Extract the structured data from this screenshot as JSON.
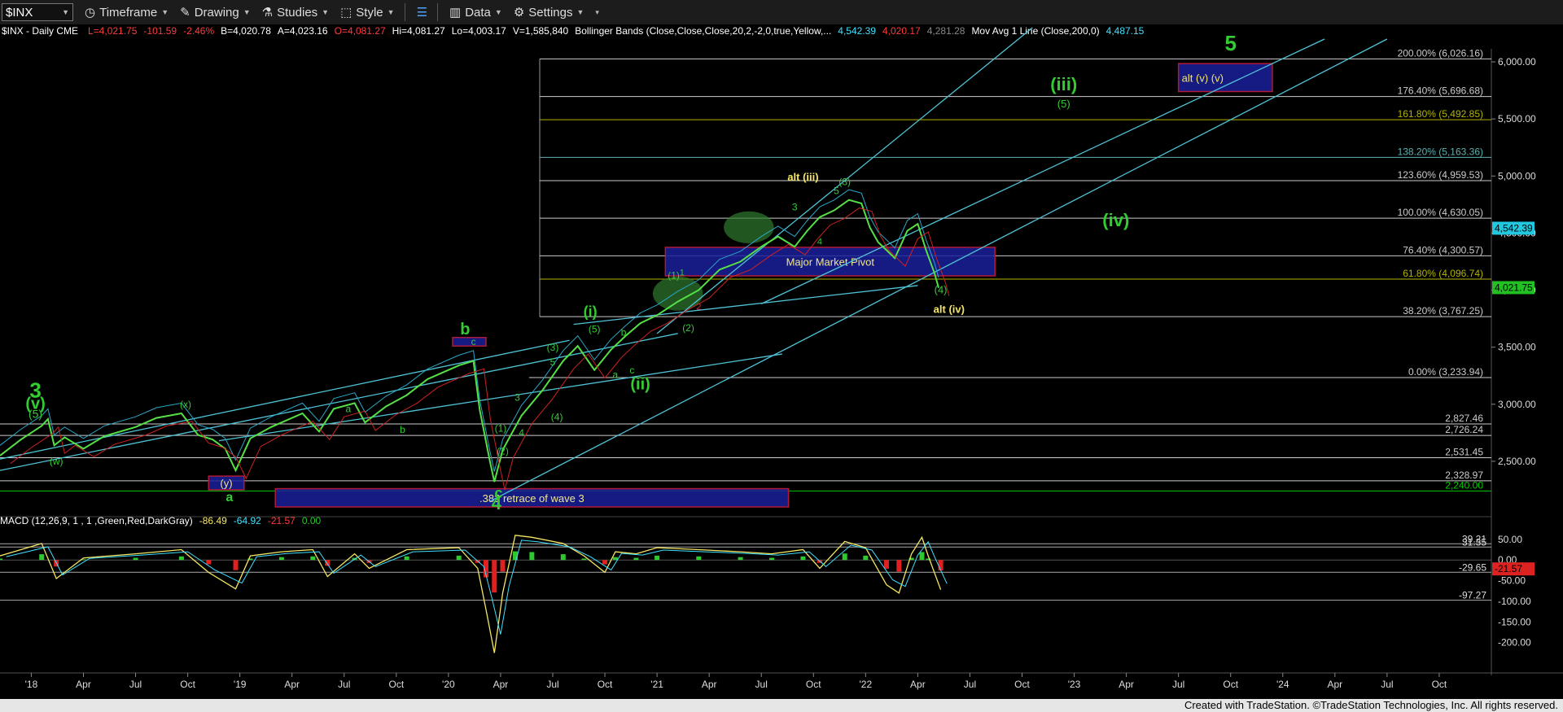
{
  "toolbar": {
    "symbol": "$INX",
    "items": [
      "Timeframe",
      "Drawing",
      "Studies",
      "Style",
      "Data",
      "Settings"
    ]
  },
  "header": {
    "symbol_info": "$INX - Daily  CME",
    "ohlc": [
      {
        "text": "L=4,021.75",
        "color": "#ff3b3b"
      },
      {
        "text": "-101.59",
        "color": "#ff3b3b"
      },
      {
        "text": "-2.46%",
        "color": "#ff3b3b"
      },
      {
        "text": "B=4,020.78",
        "color": "#ffffff"
      },
      {
        "text": "A=4,023.16",
        "color": "#ffffff"
      },
      {
        "text": "O=4,081.27",
        "color": "#ff3b3b"
      },
      {
        "text": "Hi=4,081.27",
        "color": "#ffffff"
      },
      {
        "text": "Lo=4,003.17",
        "color": "#ffffff"
      },
      {
        "text": "V=1,585,840",
        "color": "#ffffff"
      },
      {
        "text": "Bollinger Bands (Close,Close,Close,20,2,-2,0,true,Yellow,...",
        "color": "#ffffff"
      },
      {
        "text": "4,542.39",
        "color": "#3fe0ff"
      },
      {
        "text": "4,020.17",
        "color": "#ff3b3b"
      },
      {
        "text": "4,281.28",
        "color": "#888888"
      },
      {
        "text": "Mov Avg 1 Line (Close,200,0)",
        "color": "#ffffff"
      },
      {
        "text": "4,487.15",
        "color": "#3fe0ff"
      }
    ],
    "macd_label": "MACD (12,26,9, 1 , 1 ,Green,Red,DarkGray)",
    "macd_values": [
      {
        "text": "-86.49",
        "color": "#f5e663"
      },
      {
        "text": "-64.92",
        "color": "#3fe0ff"
      },
      {
        "text": "-21.57",
        "color": "#ff3b3b"
      },
      {
        "text": "0.00",
        "color": "#27c427"
      }
    ]
  },
  "footer": {
    "text": "Created with TradeStation. ©TradeStation Technologies, Inc. All rights reserved."
  },
  "chart_data": [
    {
      "type": "line",
      "title": "$INX - Daily",
      "y_axis_ticks": [
        "6,000.00",
        "5,500.00",
        "5,000.00",
        "4,500.00",
        "4,000.00",
        "3,500.00",
        "3,000.00",
        "2,500.00"
      ],
      "y_axis_tick_values": [
        6000,
        5500,
        5000,
        4500,
        4000,
        3500,
        3000,
        2500
      ],
      "ylim": [
        2050,
        6200
      ],
      "x_axis_ticks": [
        "'18",
        "Apr",
        "Jul",
        "Oct",
        "'19",
        "Apr",
        "Jul",
        "Oct",
        "'20",
        "Apr",
        "Jul",
        "Oct",
        "'21",
        "Apr",
        "Jul",
        "Oct",
        "'22",
        "Apr",
        "Jul",
        "Oct",
        "'23",
        "Apr",
        "Jul",
        "Oct",
        "'24",
        "Apr",
        "Jul",
        "Oct"
      ],
      "x_axis_tick_values": [
        2018.0,
        2018.25,
        2018.5,
        2018.75,
        2019.0,
        2019.25,
        2019.5,
        2019.75,
        2020.0,
        2020.25,
        2020.5,
        2020.75,
        2021.0,
        2021.25,
        2021.5,
        2021.75,
        2022.0,
        2022.25,
        2022.5,
        2022.75,
        2023.0,
        2023.25,
        2023.5,
        2023.75,
        2024.0,
        2024.25,
        2024.5,
        2024.75
      ],
      "xlim": [
        2017.85,
        2025.0
      ],
      "series": [
        {
          "x": [
            2017.85,
            2017.95,
            2018.05,
            2018.08,
            2018.11,
            2018.16,
            2018.25,
            2018.35,
            2018.5,
            2018.6,
            2018.72,
            2018.8,
            2018.87,
            2018.93,
            2018.98,
            2019.05,
            2019.15,
            2019.3,
            2019.38,
            2019.45,
            2019.55,
            2019.6,
            2019.7,
            2019.8,
            2019.9,
            2020.05,
            2020.12,
            2020.15,
            2020.2,
            2020.22,
            2020.26,
            2020.35,
            2020.45,
            2020.55,
            2020.62,
            2020.7,
            2020.78,
            2020.85,
            2020.92,
            2021.0,
            2021.1,
            2021.2,
            2021.3,
            2021.4,
            2021.5,
            2021.58,
            2021.66,
            2021.72,
            2021.78,
            2021.85,
            2021.92,
            2021.98,
            2022.02,
            2022.06,
            2022.1,
            2022.14,
            2022.2,
            2022.25,
            2022.29,
            2022.33,
            2022.35
          ],
          "y": [
            2550,
            2690,
            2810,
            2870,
            2640,
            2710,
            2610,
            2720,
            2800,
            2880,
            2920,
            2730,
            2690,
            2610,
            2420,
            2700,
            2800,
            2920,
            2760,
            2960,
            3010,
            2840,
            2980,
            3080,
            3220,
            3340,
            3380,
            2950,
            2490,
            2320,
            2600,
            2900,
            3120,
            3380,
            3510,
            3300,
            3480,
            3600,
            3710,
            3780,
            3900,
            4000,
            4180,
            4250,
            4380,
            4470,
            4380,
            4520,
            4640,
            4700,
            4790,
            4760,
            4550,
            4420,
            4350,
            4280,
            4520,
            4580,
            4350,
            4150,
            4020
          ]
        }
      ],
      "price_levels": [
        {
          "value": 2240,
          "label": "2,240.00",
          "color": "#00cc00"
        },
        {
          "value": 2328.97,
          "label": "2,328.97",
          "color": "#cccccc"
        },
        {
          "value": 2531.45,
          "label": "2,531.45",
          "color": "#cccccc"
        },
        {
          "value": 2726.24,
          "label": "2,726.24",
          "color": "#cccccc"
        },
        {
          "value": 2827.46,
          "label": "2,827.46",
          "color": "#cccccc"
        }
      ],
      "fib_levels": [
        {
          "value": 3233.94,
          "label": "0.00% (3,233.94)",
          "color": "#cccccc"
        },
        {
          "value": 3767.25,
          "label": "38.20% (3,767.25)",
          "color": "#cccccc"
        },
        {
          "value": 4096.74,
          "label": "61.80% (4,096.74)",
          "color": "#b3b300"
        },
        {
          "value": 4300.57,
          "label": "76.40% (4,300.57)",
          "color": "#cccccc"
        },
        {
          "value": 4630.05,
          "label": "100.00% (4,630.05)",
          "color": "#cccccc"
        },
        {
          "value": 4959.53,
          "label": "123.60% (4,959.53)",
          "color": "#cccccc"
        },
        {
          "value": 5163.36,
          "label": "138.20% (5,163.36)",
          "color": "#5fb0b0"
        },
        {
          "value": 5492.85,
          "label": "161.80% (5,492.85)",
          "color": "#b3b300"
        },
        {
          "value": 5696.68,
          "label": "176.40% (5,696.68)",
          "color": "#cccccc"
        },
        {
          "value": 6026.16,
          "label": "200.00% (6,026.16)",
          "color": "#cccccc"
        }
      ],
      "price_badges": [
        {
          "value": 4542.39,
          "label": "4,542.39",
          "color": "#22c7e0"
        },
        {
          "value": 4021.75,
          "label": "4,021.75",
          "color": "#22c022"
        }
      ],
      "trend_lines": [
        {
          "x1": 2017.85,
          "y1": 2420,
          "x2": 2021.1,
          "y2": 3620
        },
        {
          "x1": 2017.85,
          "y1": 2520,
          "x2": 2020.58,
          "y2": 3560
        },
        {
          "x1": 2018.9,
          "y1": 2680,
          "x2": 2021.6,
          "y2": 3440
        },
        {
          "x1": 2020.2,
          "y1": 2150,
          "x2": 2024.5,
          "y2": 6200
        },
        {
          "x1": 2021.0,
          "y1": 3620,
          "x2": 2022.8,
          "y2": 6300
        },
        {
          "x1": 2021.5,
          "y1": 3880,
          "x2": 2024.2,
          "y2": 6200
        },
        {
          "x1": 2020.6,
          "y1": 3700,
          "x2": 2022.25,
          "y2": 4040
        }
      ],
      "zones": [
        {
          "x1": 2018.85,
          "x2": 2019.02,
          "y1": 2250,
          "y2": 2370,
          "label": "(y)"
        },
        {
          "x1": 2020.02,
          "x2": 2020.18,
          "y1": 3510,
          "y2": 3585,
          "label": ""
        },
        {
          "x1": 2019.17,
          "x2": 2021.63,
          "y1": 2100,
          "y2": 2260,
          "label": ".382 retrace of wave 3"
        },
        {
          "x1": 2021.04,
          "x2": 2022.62,
          "y1": 4125,
          "y2": 4375,
          "label": "Major Market Pivot"
        },
        {
          "x1": 2023.5,
          "x2": 2023.95,
          "y1": 5740,
          "y2": 5985,
          "label": "alt (v) (v)"
        }
      ],
      "ellipses": [
        {
          "cx": 2021.44,
          "cy": 4550,
          "rx": 0.12,
          "ry": 140
        },
        {
          "cx": 2021.1,
          "cy": 3970,
          "rx": 0.12,
          "ry": 150
        }
      ],
      "annotations": [
        {
          "text": "3",
          "x": 2018.02,
          "y": 3060,
          "color": "#33cc33",
          "size": 26,
          "bold": true
        },
        {
          "text": "(v)",
          "x": 2018.02,
          "y": 2960,
          "color": "#33cc33",
          "size": 20,
          "bold": true
        },
        {
          "text": "(5)",
          "x": 2018.02,
          "y": 2880,
          "color": "#33cc33",
          "size": 14
        },
        {
          "text": "(w)",
          "x": 2018.12,
          "y": 2470,
          "color": "#33cc33",
          "size": 12
        },
        {
          "text": "(x)",
          "x": 2018.74,
          "y": 2970,
          "color": "#33cc33",
          "size": 12
        },
        {
          "text": "a",
          "x": 2018.95,
          "y": 2150,
          "color": "#33cc33",
          "size": 16,
          "bold": true
        },
        {
          "text": "a",
          "x": 2019.52,
          "y": 2930,
          "color": "#33cc33",
          "size": 12
        },
        {
          "text": "b",
          "x": 2019.78,
          "y": 2750,
          "color": "#33cc33",
          "size": 12
        },
        {
          "text": "b",
          "x": 2020.08,
          "y": 3610,
          "color": "#33cc33",
          "size": 20,
          "bold": true
        },
        {
          "text": "c",
          "x": 2020.12,
          "y": 3520,
          "color": "#33cc33",
          "size": 12
        },
        {
          "text": "c",
          "x": 2020.24,
          "y": 2180,
          "color": "#33cc33",
          "size": 18,
          "bold": true
        },
        {
          "text": "4",
          "x": 2020.23,
          "y": 2080,
          "color": "#33cc33",
          "size": 22,
          "bold": true
        },
        {
          "text": "(1)",
          "x": 2020.25,
          "y": 2760,
          "color": "#33cc33",
          "size": 12
        },
        {
          "text": "(2)",
          "x": 2020.26,
          "y": 2560,
          "color": "#33cc33",
          "size": 12
        },
        {
          "text": "3",
          "x": 2020.33,
          "y": 3030,
          "color": "#33cc33",
          "size": 12
        },
        {
          "text": "4",
          "x": 2020.35,
          "y": 2720,
          "color": "#33cc33",
          "size": 12
        },
        {
          "text": "(3)",
          "x": 2020.5,
          "y": 3470,
          "color": "#33cc33",
          "size": 12
        },
        {
          "text": "5",
          "x": 2020.5,
          "y": 3340,
          "color": "#33cc33",
          "size": 12
        },
        {
          "text": "(4)",
          "x": 2020.52,
          "y": 2860,
          "color": "#33cc33",
          "size": 12
        },
        {
          "text": "(5)",
          "x": 2020.7,
          "y": 3630,
          "color": "#33cc33",
          "size": 12
        },
        {
          "text": "(i)",
          "x": 2020.68,
          "y": 3770,
          "color": "#33cc33",
          "size": 18,
          "bold": true
        },
        {
          "text": "a",
          "x": 2020.8,
          "y": 3230,
          "color": "#33cc33",
          "size": 12
        },
        {
          "text": "b",
          "x": 2020.84,
          "y": 3600,
          "color": "#33cc33",
          "size": 12
        },
        {
          "text": "c",
          "x": 2020.88,
          "y": 3270,
          "color": "#33cc33",
          "size": 12
        },
        {
          "text": "(ii)",
          "x": 2020.92,
          "y": 3130,
          "color": "#33cc33",
          "size": 20,
          "bold": true
        },
        {
          "text": "(1)",
          "x": 2021.08,
          "y": 4100,
          "color": "#33cc33",
          "size": 12
        },
        {
          "text": "1",
          "x": 2021.12,
          "y": 4130,
          "color": "#33cc33",
          "size": 11
        },
        {
          "text": "2",
          "x": 2021.2,
          "y": 3830,
          "color": "#cc3333",
          "size": 11
        },
        {
          "text": "(2)",
          "x": 2021.15,
          "y": 3640,
          "color": "#33cc33",
          "size": 12
        },
        {
          "text": "3",
          "x": 2021.66,
          "y": 4700,
          "color": "#33cc33",
          "size": 12
        },
        {
          "text": "alt (iii)",
          "x": 2021.7,
          "y": 4960,
          "color": "#f5e663",
          "size": 13,
          "bold": true
        },
        {
          "text": "5",
          "x": 2021.86,
          "y": 4840,
          "color": "#33cc33",
          "size": 12
        },
        {
          "text": "(3)",
          "x": 2021.9,
          "y": 4920,
          "color": "#33cc33",
          "size": 12
        },
        {
          "text": "4",
          "x": 2021.78,
          "y": 4400,
          "color": "#33cc33",
          "size": 11
        },
        {
          "text": "(4)",
          "x": 2022.36,
          "y": 3970,
          "color": "#33cc33",
          "size": 13
        },
        {
          "text": "alt (iv)",
          "x": 2022.4,
          "y": 3800,
          "color": "#f5e663",
          "size": 13,
          "bold": true
        },
        {
          "text": "(iii)",
          "x": 2022.95,
          "y": 5750,
          "color": "#33cc33",
          "size": 22,
          "bold": true
        },
        {
          "text": "(5)",
          "x": 2022.95,
          "y": 5600,
          "color": "#33cc33",
          "size": 13
        },
        {
          "text": "(iv)",
          "x": 2023.2,
          "y": 4560,
          "color": "#33cc33",
          "size": 22,
          "bold": true
        },
        {
          "text": "5",
          "x": 2023.75,
          "y": 6100,
          "color": "#33cc33",
          "size": 26,
          "bold": true
        }
      ]
    },
    {
      "type": "line",
      "title": "MACD (12,26,9, 1 , 1 ,Green,Red,DarkGray)",
      "y_axis_ticks": [
        "50.00",
        "0.00",
        "-50.00",
        "-100.00",
        "-150.00",
        "-200.00"
      ],
      "y_axis_tick_values": [
        50,
        0,
        -50,
        -100,
        -150,
        -200
      ],
      "ylim": [
        -240,
        95
      ],
      "levels": [
        {
          "value": 39.21,
          "label": "39.21"
        },
        {
          "value": 31.35,
          "label": "31.35"
        },
        {
          "value": -29.65,
          "label": "-29.65"
        },
        {
          "value": -97.27,
          "label": "-97.27"
        }
      ],
      "value_badge": {
        "value": -21.57,
        "label": "-21.57",
        "color": "#dd2222"
      },
      "series": [
        {
          "name": "MACD",
          "x": [
            2017.85,
            2018.05,
            2018.12,
            2018.25,
            2018.5,
            2018.72,
            2018.85,
            2018.98,
            2019.05,
            2019.2,
            2019.35,
            2019.42,
            2019.55,
            2019.62,
            2019.8,
            2020.05,
            2020.14,
            2020.18,
            2020.22,
            2020.26,
            2020.32,
            2020.4,
            2020.55,
            2020.65,
            2020.75,
            2020.8,
            2020.9,
            2021.0,
            2021.2,
            2021.4,
            2021.55,
            2021.7,
            2021.78,
            2021.9,
            2022.0,
            2022.1,
            2022.16,
            2022.22,
            2022.27,
            2022.3,
            2022.36
          ],
          "y": [
            10,
            40,
            -45,
            5,
            15,
            25,
            -30,
            -70,
            10,
            20,
            25,
            -40,
            15,
            -20,
            25,
            30,
            -20,
            -120,
            -225,
            -80,
            60,
            55,
            40,
            10,
            -30,
            20,
            15,
            30,
            25,
            20,
            15,
            25,
            -20,
            45,
            30,
            -60,
            -80,
            15,
            55,
            10,
            -72
          ]
        }
      ]
    }
  ]
}
